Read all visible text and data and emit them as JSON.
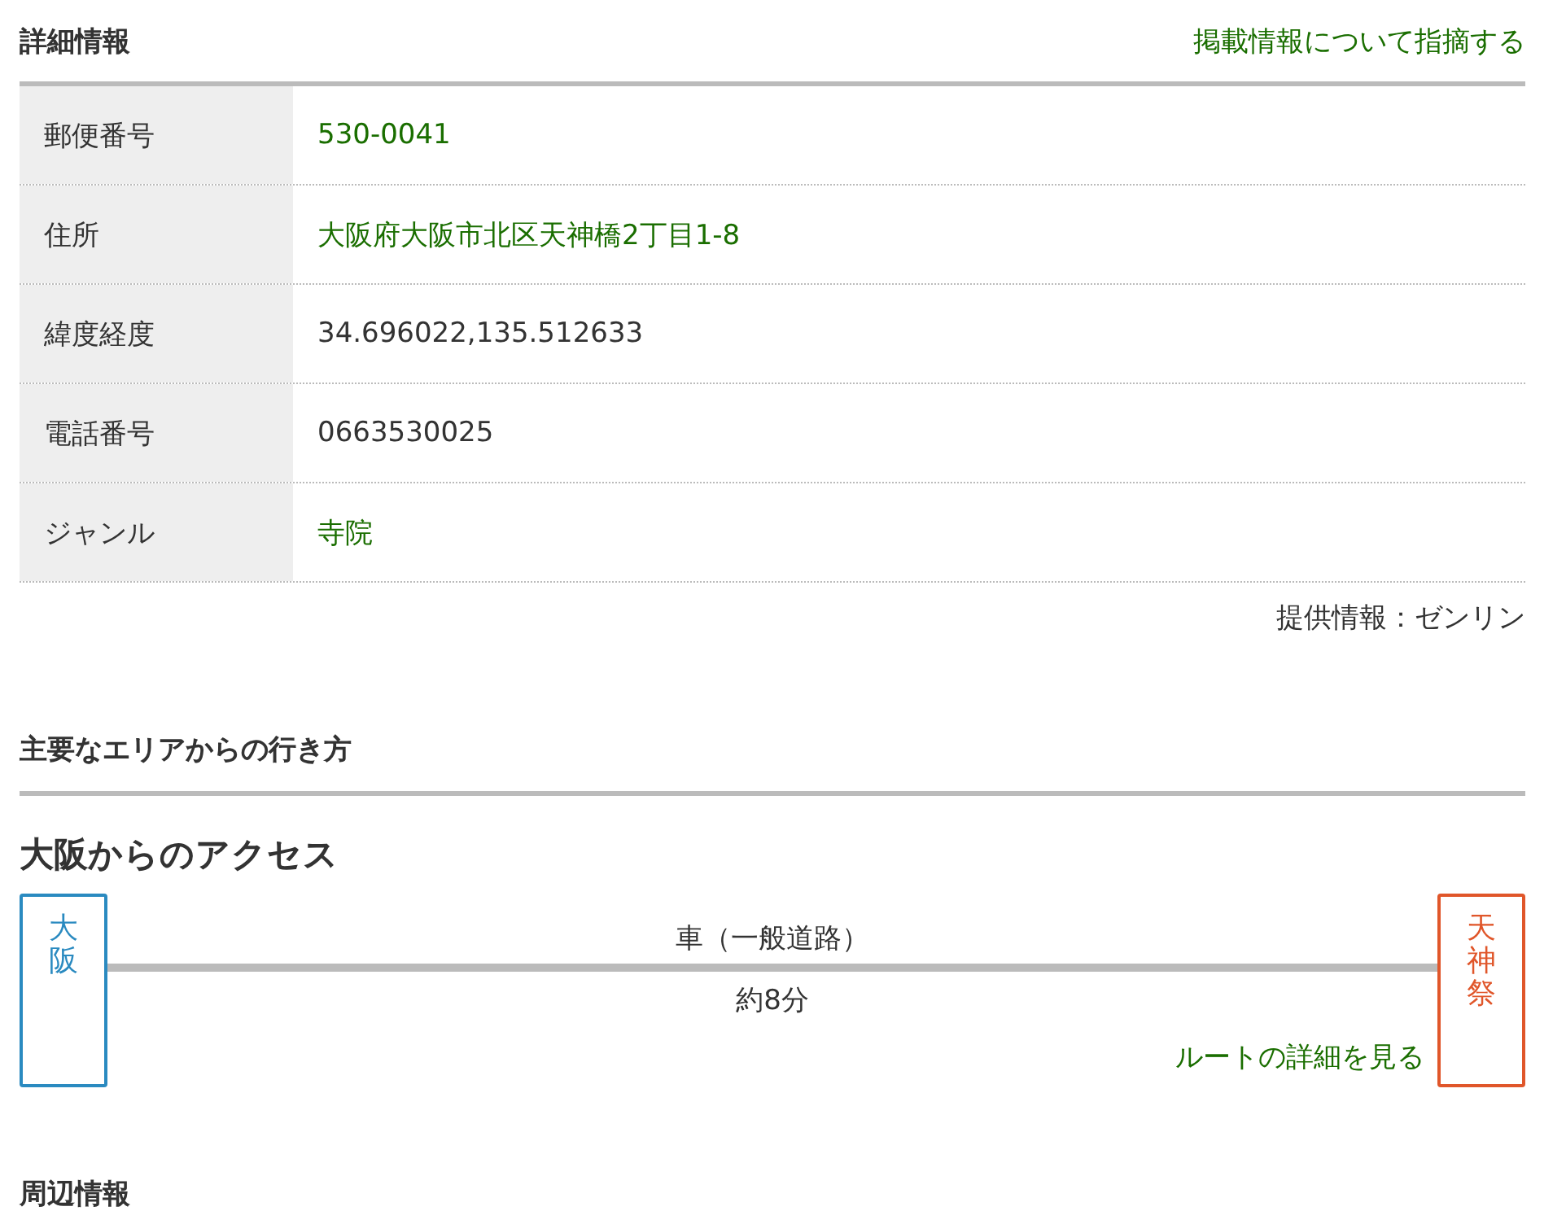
{
  "details": {
    "heading": "詳細情報",
    "report_link": "掲載情報について指摘する",
    "rows": [
      {
        "label": "郵便番号",
        "value": "530-0041",
        "link": true
      },
      {
        "label": "住所",
        "value": "大阪府大阪市北区天神橋2丁目1-8",
        "link": true
      },
      {
        "label": "緯度経度",
        "value": "34.696022,135.512633",
        "link": false
      },
      {
        "label": "電話番号",
        "value": "0663530025",
        "link": false
      },
      {
        "label": "ジャンル",
        "value": "寺院",
        "link": true
      }
    ],
    "source": "提供情報：ゼンリン"
  },
  "access": {
    "heading": "主要なエリアからの行き方",
    "title": "大阪からのアクセス",
    "from": "大阪",
    "to": "天神祭",
    "mode": "車（一般道路）",
    "duration": "約8分",
    "route_link": "ルートの詳細を見る"
  },
  "nearby": {
    "heading": "周辺情報"
  }
}
